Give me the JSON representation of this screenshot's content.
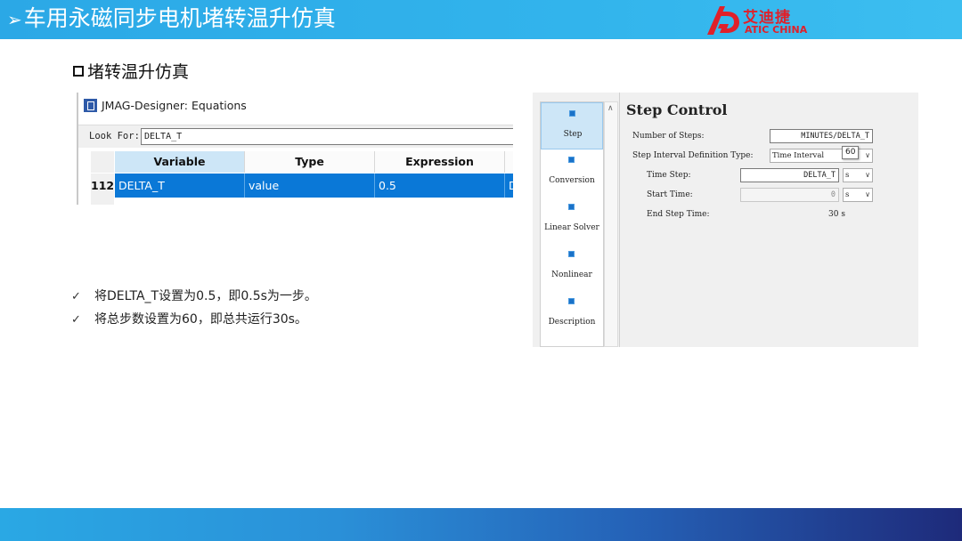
{
  "header": {
    "title": "车用永磁同步电机堵转温升仿真",
    "arrow": "➢",
    "logo_cn": "艾迪捷",
    "logo_en": "ATIC CHINA",
    "color": "#32b4ec"
  },
  "section": {
    "title": "堵转温升仿真"
  },
  "equations_window": {
    "title": "JMAG-Designer: Equations",
    "look_for_label": "Look For:",
    "look_for_value": "DELTA_T",
    "columns": [
      "Variable",
      "Type",
      "Expression"
    ],
    "row": {
      "number": "112",
      "variable": "DELTA_T",
      "type": "value",
      "expression": "0.5",
      "extra": "D"
    }
  },
  "notes": [
    "将DELTA_T设置为0.5，即0.5s为一步。",
    "将总步数设置为60，即总共运行30s。"
  ],
  "step_control": {
    "nav": [
      "Step",
      "Conversion",
      "Linear Solver",
      "Nonlinear",
      "Description"
    ],
    "active_nav": "Step",
    "title": "Step Control",
    "number_of_steps_label": "Number of Steps:",
    "number_of_steps_value": "MINUTES/DELTA_T",
    "interval_type_label": "Step Interval Definition Type:",
    "interval_type_value": "Time Interval",
    "tooltip_value": "60",
    "time_step_label": "Time Step:",
    "time_step_value": "DELTA_T",
    "time_step_unit": "s",
    "start_time_label": "Start Time:",
    "start_time_value": "0",
    "start_time_unit": "s",
    "end_time_label": "End Step Time:",
    "end_time_value": "30 s"
  }
}
